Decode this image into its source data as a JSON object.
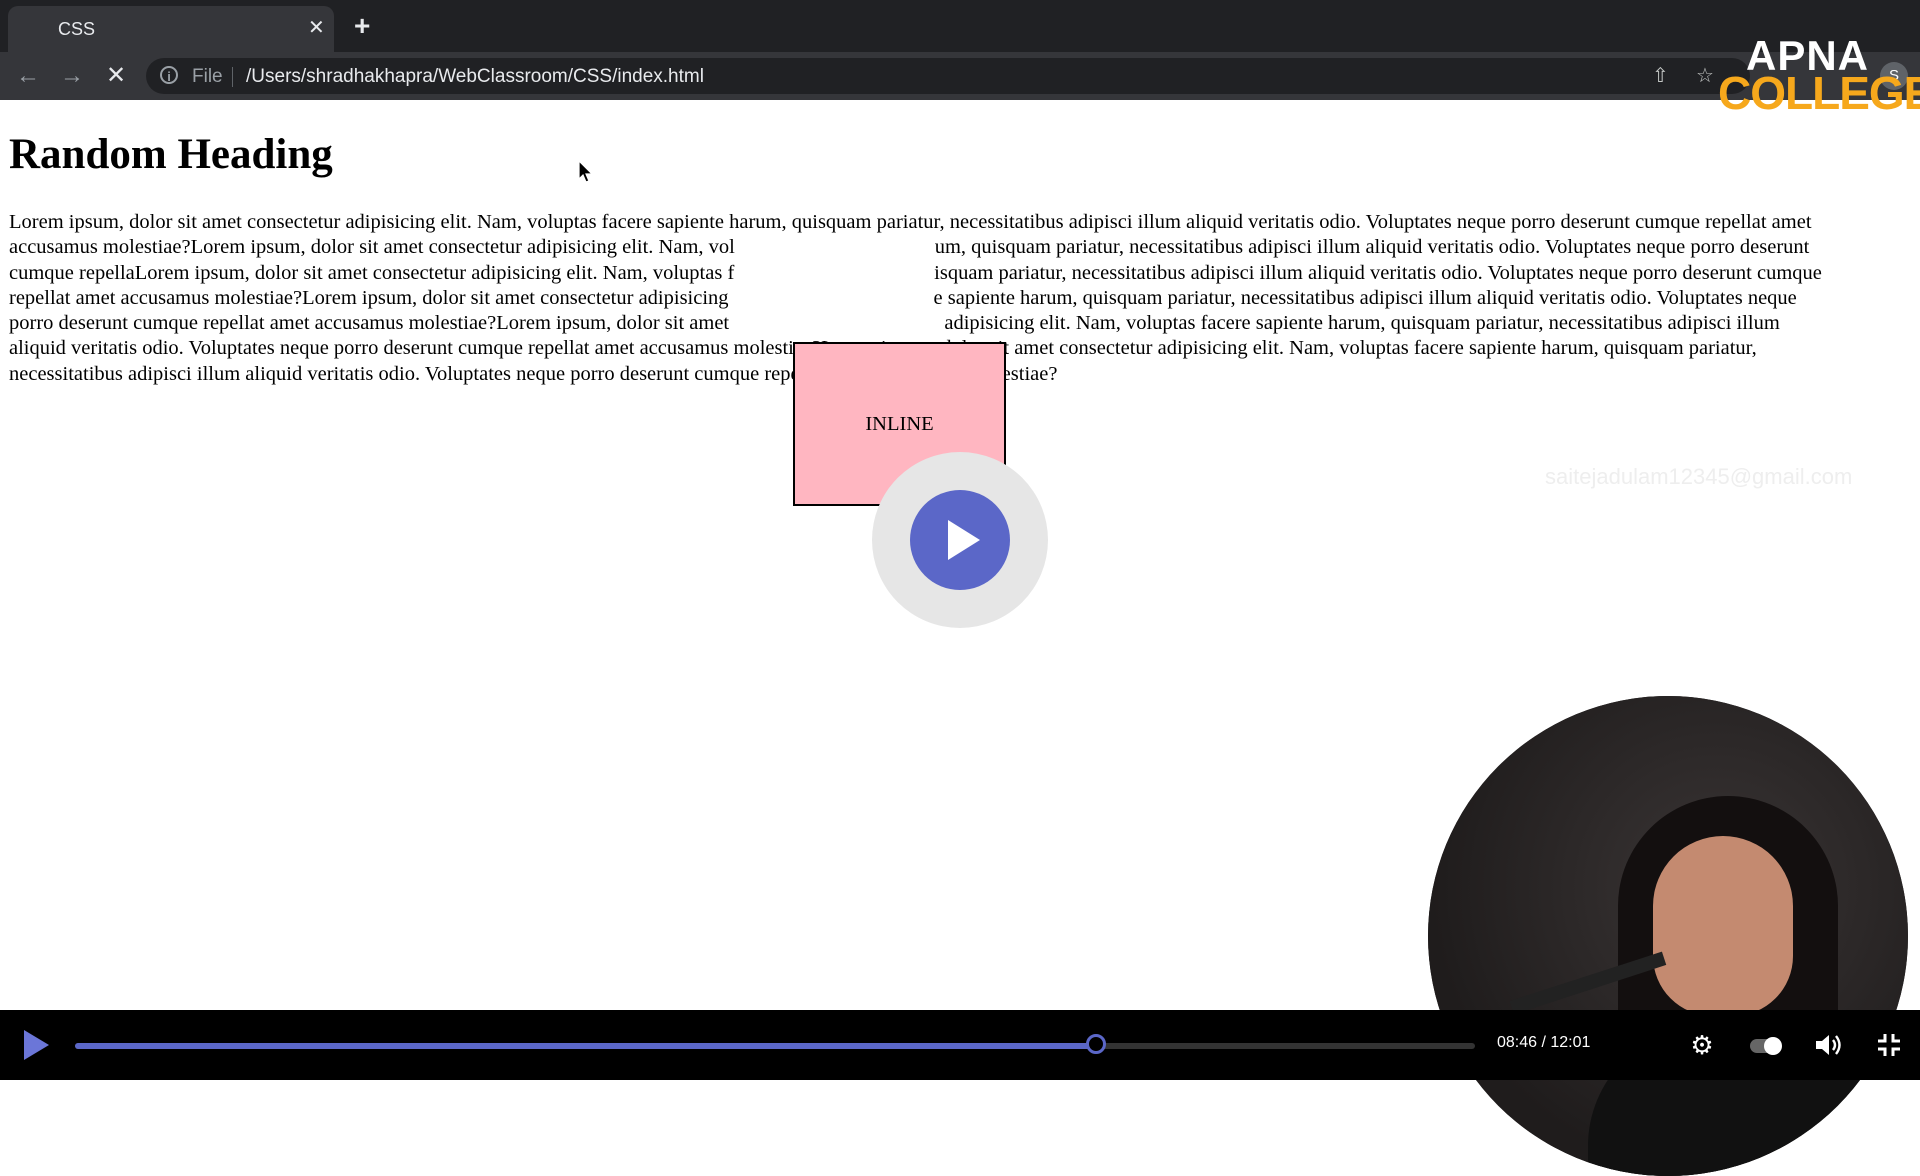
{
  "browser": {
    "tab_title": "CSS",
    "tab_close": "✕",
    "new_tab": "+",
    "scheme": "File",
    "url": "/Users/shradhakhapra/WebClassroom/CSS/index.html",
    "profile_initial": "S"
  },
  "logo": {
    "top": "APNA",
    "bottom": "COLLEGE",
    "color_top": "#ffffff",
    "color_bottom": "#f6a81c"
  },
  "page": {
    "heading": "Random Heading",
    "paragraph_lines": [
      "Lorem ipsum, dolor sit amet consectetur adipisicing elit. Nam, voluptas facere sapiente harum, quisquam pariatur, necessitatibus adipisci illum aliquid veritatis odio. Voluptates neque porro deserunt cumque repellat amet",
      "accusamus molestiae?Lorem ipsum, dolor sit amet consectetur adipisicing elit. Nam, vol                                       um, quisquam pariatur, necessitatibus adipisci illum aliquid veritatis odio. Voluptates neque porro deserunt",
      "cumque repellaLorem ipsum, dolor sit amet consectetur adipisicing elit. Nam, voluptas f                                       isquam pariatur, necessitatibus adipisci illum aliquid veritatis odio. Voluptates neque porro deserunt cumque",
      "repellat amet accusamus molestiae?Lorem ipsum, dolor sit amet consectetur adipisicing                                        e sapiente harum, quisquam pariatur, necessitatibus adipisci illum aliquid veritatis odio. Voluptates neque",
      "porro deserunt cumque repellat amet accusamus molestiae?Lorem ipsum, dolor sit amet                                          adipisicing elit. Nam, voluptas facere sapiente harum, quisquam pariatur, necessitatibus adipisci illum",
      "aliquid veritatis odio. Voluptates neque porro deserunt cumque repellat amet accusamus molestiae?Lorem ipsum, dolor sit amet consectetur adipisicing elit. Nam, voluptas facere sapiente harum, quisquam pariatur,",
      "necessitatibus adipisci illum aliquid veritatis odio. Voluptates neque porro deserunt cumque repellat amet accusamus molestiae?"
    ],
    "inline_box_label": "INLINE",
    "inline_box_color": "#ffb6c1"
  },
  "watermark": "saitejadulam12345@gmail.com",
  "player": {
    "accent": "#5b67c8",
    "current_time": "08:46",
    "total_time": "12:01",
    "time_display": "08:46 / 12:01",
    "progress_fraction": 0.7295
  },
  "icons": {
    "back": "back-arrow-icon",
    "forward": "forward-arrow-icon",
    "stop": "stop-loading-icon",
    "info": "info-icon",
    "share": "share-icon",
    "star": "bookmark-star-icon",
    "play": "play-icon",
    "settings": "gear-icon",
    "volume": "volume-icon",
    "fullscreen": "fullscreen-exit-icon"
  }
}
